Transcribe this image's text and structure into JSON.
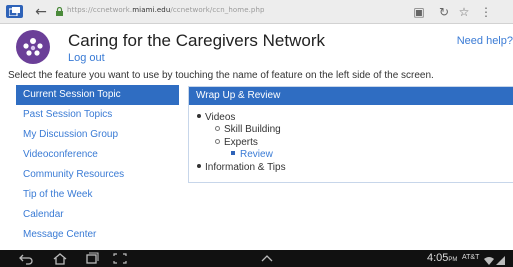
{
  "browser": {
    "url_prefix": "https://ccnetwork.",
    "url_domain": "miami.edu",
    "url_path": "/ccnetwork/ccn_home.php"
  },
  "header": {
    "title": "Caring for the Caregivers Network",
    "logout_label": "Log out",
    "help_label": "Need help?"
  },
  "instructions": "Select the feature you want to use by touching the name of feature on the left side of the screen.",
  "sidebar": {
    "items": [
      {
        "label": "Current Session Topic"
      },
      {
        "label": "Past Session Topics"
      },
      {
        "label": "My Discussion Group"
      },
      {
        "label": "Videoconference"
      },
      {
        "label": "Community Resources"
      },
      {
        "label": "Tip of the Week"
      },
      {
        "label": "Calendar"
      },
      {
        "label": "Message Center"
      }
    ]
  },
  "panel": {
    "title": "Wrap Up & Review",
    "tree": {
      "videos": "Videos",
      "skill_building": "Skill Building",
      "experts": "Experts",
      "review": "Review",
      "info_tips": "Information & Tips"
    }
  },
  "status_bar": {
    "time": "4:05",
    "ampm": "PM",
    "carrier": "AT&T"
  },
  "colors": {
    "accent": "#2f6dc2",
    "link": "#3a7bd5",
    "logo": "#6b3f98"
  }
}
